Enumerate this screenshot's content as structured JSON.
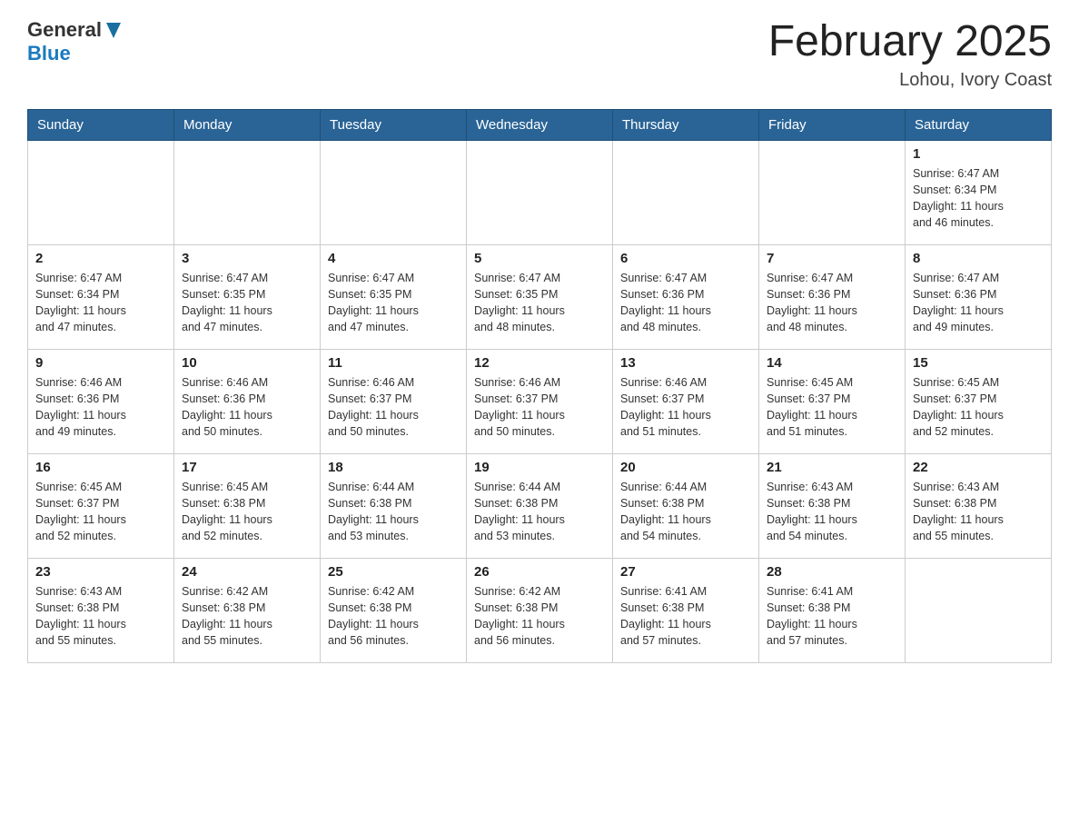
{
  "header": {
    "logo_general": "General",
    "logo_blue": "Blue",
    "month_title": "February 2025",
    "subtitle": "Lohou, Ivory Coast"
  },
  "weekdays": [
    "Sunday",
    "Monday",
    "Tuesday",
    "Wednesday",
    "Thursday",
    "Friday",
    "Saturday"
  ],
  "weeks": [
    [
      {
        "day": "",
        "info": ""
      },
      {
        "day": "",
        "info": ""
      },
      {
        "day": "",
        "info": ""
      },
      {
        "day": "",
        "info": ""
      },
      {
        "day": "",
        "info": ""
      },
      {
        "day": "",
        "info": ""
      },
      {
        "day": "1",
        "info": "Sunrise: 6:47 AM\nSunset: 6:34 PM\nDaylight: 11 hours\nand 46 minutes."
      }
    ],
    [
      {
        "day": "2",
        "info": "Sunrise: 6:47 AM\nSunset: 6:34 PM\nDaylight: 11 hours\nand 47 minutes."
      },
      {
        "day": "3",
        "info": "Sunrise: 6:47 AM\nSunset: 6:35 PM\nDaylight: 11 hours\nand 47 minutes."
      },
      {
        "day": "4",
        "info": "Sunrise: 6:47 AM\nSunset: 6:35 PM\nDaylight: 11 hours\nand 47 minutes."
      },
      {
        "day": "5",
        "info": "Sunrise: 6:47 AM\nSunset: 6:35 PM\nDaylight: 11 hours\nand 48 minutes."
      },
      {
        "day": "6",
        "info": "Sunrise: 6:47 AM\nSunset: 6:36 PM\nDaylight: 11 hours\nand 48 minutes."
      },
      {
        "day": "7",
        "info": "Sunrise: 6:47 AM\nSunset: 6:36 PM\nDaylight: 11 hours\nand 48 minutes."
      },
      {
        "day": "8",
        "info": "Sunrise: 6:47 AM\nSunset: 6:36 PM\nDaylight: 11 hours\nand 49 minutes."
      }
    ],
    [
      {
        "day": "9",
        "info": "Sunrise: 6:46 AM\nSunset: 6:36 PM\nDaylight: 11 hours\nand 49 minutes."
      },
      {
        "day": "10",
        "info": "Sunrise: 6:46 AM\nSunset: 6:36 PM\nDaylight: 11 hours\nand 50 minutes."
      },
      {
        "day": "11",
        "info": "Sunrise: 6:46 AM\nSunset: 6:37 PM\nDaylight: 11 hours\nand 50 minutes."
      },
      {
        "day": "12",
        "info": "Sunrise: 6:46 AM\nSunset: 6:37 PM\nDaylight: 11 hours\nand 50 minutes."
      },
      {
        "day": "13",
        "info": "Sunrise: 6:46 AM\nSunset: 6:37 PM\nDaylight: 11 hours\nand 51 minutes."
      },
      {
        "day": "14",
        "info": "Sunrise: 6:45 AM\nSunset: 6:37 PM\nDaylight: 11 hours\nand 51 minutes."
      },
      {
        "day": "15",
        "info": "Sunrise: 6:45 AM\nSunset: 6:37 PM\nDaylight: 11 hours\nand 52 minutes."
      }
    ],
    [
      {
        "day": "16",
        "info": "Sunrise: 6:45 AM\nSunset: 6:37 PM\nDaylight: 11 hours\nand 52 minutes."
      },
      {
        "day": "17",
        "info": "Sunrise: 6:45 AM\nSunset: 6:38 PM\nDaylight: 11 hours\nand 52 minutes."
      },
      {
        "day": "18",
        "info": "Sunrise: 6:44 AM\nSunset: 6:38 PM\nDaylight: 11 hours\nand 53 minutes."
      },
      {
        "day": "19",
        "info": "Sunrise: 6:44 AM\nSunset: 6:38 PM\nDaylight: 11 hours\nand 53 minutes."
      },
      {
        "day": "20",
        "info": "Sunrise: 6:44 AM\nSunset: 6:38 PM\nDaylight: 11 hours\nand 54 minutes."
      },
      {
        "day": "21",
        "info": "Sunrise: 6:43 AM\nSunset: 6:38 PM\nDaylight: 11 hours\nand 54 minutes."
      },
      {
        "day": "22",
        "info": "Sunrise: 6:43 AM\nSunset: 6:38 PM\nDaylight: 11 hours\nand 55 minutes."
      }
    ],
    [
      {
        "day": "23",
        "info": "Sunrise: 6:43 AM\nSunset: 6:38 PM\nDaylight: 11 hours\nand 55 minutes."
      },
      {
        "day": "24",
        "info": "Sunrise: 6:42 AM\nSunset: 6:38 PM\nDaylight: 11 hours\nand 55 minutes."
      },
      {
        "day": "25",
        "info": "Sunrise: 6:42 AM\nSunset: 6:38 PM\nDaylight: 11 hours\nand 56 minutes."
      },
      {
        "day": "26",
        "info": "Sunrise: 6:42 AM\nSunset: 6:38 PM\nDaylight: 11 hours\nand 56 minutes."
      },
      {
        "day": "27",
        "info": "Sunrise: 6:41 AM\nSunset: 6:38 PM\nDaylight: 11 hours\nand 57 minutes."
      },
      {
        "day": "28",
        "info": "Sunrise: 6:41 AM\nSunset: 6:38 PM\nDaylight: 11 hours\nand 57 minutes."
      },
      {
        "day": "",
        "info": ""
      }
    ]
  ]
}
